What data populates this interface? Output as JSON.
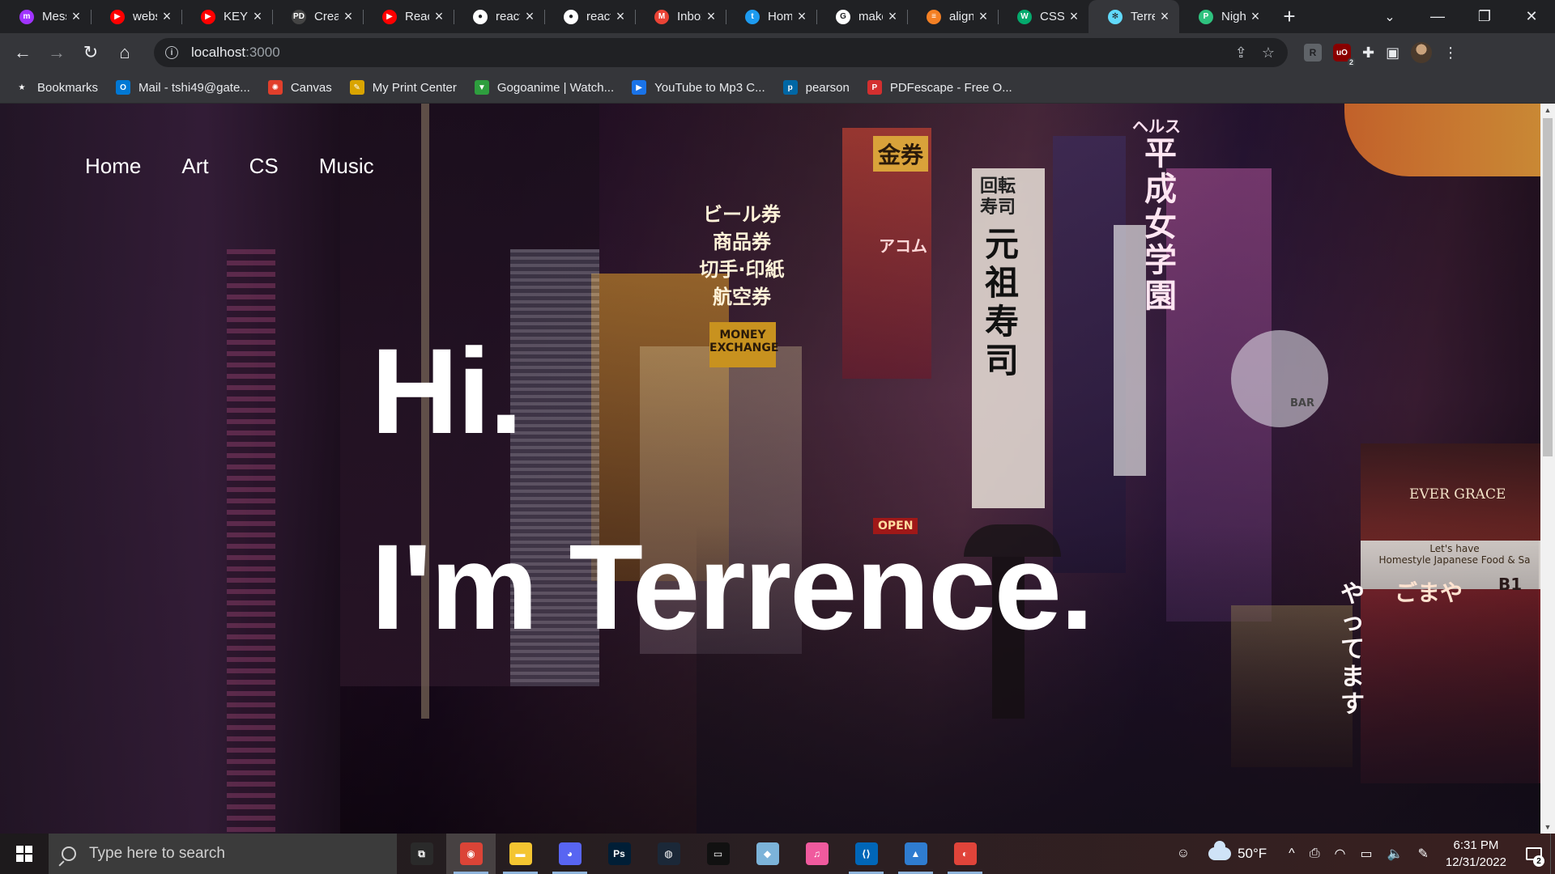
{
  "browser": {
    "tabs": [
      {
        "title": "Messenger",
        "icon": "messenger-icon",
        "color": "#a033ff",
        "glyph": "m"
      },
      {
        "title": "website",
        "icon": "youtube-icon",
        "color": "#ff0000",
        "glyph": "▶"
      },
      {
        "title": "KEY V",
        "icon": "youtube-icon",
        "color": "#ff0000",
        "glyph": "▶"
      },
      {
        "title": "Create",
        "icon": "pd-icon",
        "color": "#444444",
        "glyph": "PD"
      },
      {
        "title": "React",
        "icon": "youtube-icon",
        "color": "#ff0000",
        "glyph": "▶"
      },
      {
        "title": "react",
        "icon": "github-icon",
        "color": "#ffffff",
        "glyph": "●"
      },
      {
        "title": "react",
        "icon": "github-icon",
        "color": "#ffffff",
        "glyph": "●"
      },
      {
        "title": "Inbox",
        "icon": "gmail-icon",
        "color": "#ea4335",
        "glyph": "M"
      },
      {
        "title": "Home",
        "icon": "twitter-icon",
        "color": "#1d9bf0",
        "glyph": "t"
      },
      {
        "title": "make",
        "icon": "google-icon",
        "color": "#ffffff",
        "glyph": "G"
      },
      {
        "title": "align",
        "icon": "stackoverflow-icon",
        "color": "#f48024",
        "glyph": "≡"
      },
      {
        "title": "CSS",
        "icon": "w3schools-icon",
        "color": "#04aa6d",
        "glyph": "W"
      },
      {
        "title": "Terrence",
        "icon": "react-icon",
        "color": "#61dafb",
        "glyph": "✻",
        "active": true
      },
      {
        "title": "Nigh",
        "icon": "p-icon",
        "color": "#2ec27e",
        "glyph": "P"
      }
    ],
    "url_host": "localhost",
    "url_port": ":3000",
    "bookmarks": [
      {
        "label": "Bookmarks",
        "icon": "star-icon",
        "color": "#35363a",
        "glyph": "★"
      },
      {
        "label": "Mail - tshi49@gate...",
        "icon": "outlook-icon",
        "color": "#0078d4",
        "glyph": "O"
      },
      {
        "label": "Canvas",
        "icon": "canvas-icon",
        "color": "#e13f2b",
        "glyph": "✺"
      },
      {
        "label": "My Print Center",
        "icon": "print-center-icon",
        "color": "#d9a400",
        "glyph": "✎"
      },
      {
        "label": "Gogoanime | Watch...",
        "icon": "gogoanime-icon",
        "color": "#2e9e3e",
        "glyph": "▼"
      },
      {
        "label": "YouTube to Mp3 C...",
        "icon": "ytmp3-icon",
        "color": "#1a73e8",
        "glyph": "▶"
      },
      {
        "label": "pearson",
        "icon": "pearson-icon",
        "color": "#0067a5",
        "glyph": "p"
      },
      {
        "label": "PDFescape - Free O...",
        "icon": "pdfescape-icon",
        "color": "#d32f2f",
        "glyph": "P"
      }
    ]
  },
  "site": {
    "nav": [
      "Home",
      "Art",
      "CS",
      "Music"
    ],
    "hero_line1": "Hi.",
    "hero_line2": "I'm Terrence.",
    "background_signs": [
      "ヘルス",
      "平成女学園",
      "回転寿司",
      "元祖寿司",
      "金券",
      "ビール券",
      "商品券",
      "切手・印紙",
      "航空券",
      "MONEY EXCHANGE",
      "BAR",
      "EVER GRACE",
      "Let's have Homestyle Japanese Food & Sa",
      "B1",
      "やってます",
      "ごまや",
      "OPEN",
      "アコム"
    ]
  },
  "taskbar": {
    "search_placeholder": "Type here to search",
    "apps": [
      {
        "name": "task-view",
        "glyph": "⧉",
        "color": "#2a2a2a"
      },
      {
        "name": "chrome",
        "glyph": "◉",
        "color": "#db4437",
        "open": true,
        "active": true
      },
      {
        "name": "file-explorer",
        "glyph": "▬",
        "color": "#f4c531",
        "open": true
      },
      {
        "name": "discord",
        "glyph": "◕",
        "color": "#5865f2",
        "open": true
      },
      {
        "name": "photoshop",
        "glyph": "Ps",
        "color": "#001e36"
      },
      {
        "name": "steam",
        "glyph": "◍",
        "color": "#1b2838"
      },
      {
        "name": "terminal",
        "glyph": "▭",
        "color": "#111111"
      },
      {
        "name": "notepad",
        "glyph": "◆",
        "color": "#7cb3d9"
      },
      {
        "name": "itunes",
        "glyph": "♫",
        "color": "#f05a9e"
      },
      {
        "name": "vscode",
        "glyph": "⟨⟩",
        "color": "#0066b8",
        "open": true
      },
      {
        "name": "photos",
        "glyph": "▲",
        "color": "#2f7cd0",
        "open": true
      },
      {
        "name": "paint3d",
        "glyph": "◐",
        "color": "#e0443a",
        "open": true
      }
    ],
    "weather_temp": "50°F",
    "time": "6:31 PM",
    "date": "12/31/2022",
    "notification_count": "2"
  }
}
